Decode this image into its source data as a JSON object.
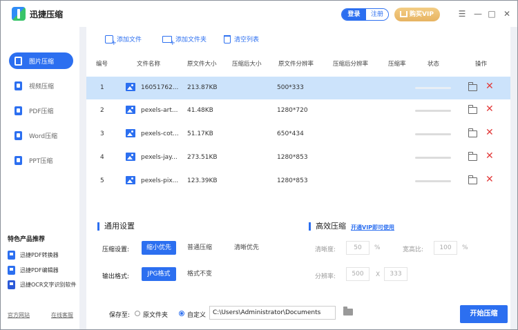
{
  "app": {
    "title": "迅捷压缩"
  },
  "header": {
    "login": "登录",
    "register": "注册",
    "vip": "购买VIP",
    "controls": {
      "menu": "☰",
      "minimize": "—",
      "maximize": "□",
      "close": "✕"
    }
  },
  "sidebar": {
    "items": [
      {
        "label": "图片压缩",
        "icon": "image-icon"
      },
      {
        "label": "视频压缩",
        "icon": "video-icon"
      },
      {
        "label": "PDF压缩",
        "icon": "pdf-icon"
      },
      {
        "label": "Word压缩",
        "icon": "word-icon"
      },
      {
        "label": "PPT压缩",
        "icon": "ppt-icon"
      }
    ],
    "featured_title": "特色产品推荐",
    "featured": [
      {
        "label": "迅捷PDF转换器",
        "icon": "pdf-converter-icon"
      },
      {
        "label": "迅捷PDF编辑器",
        "icon": "pdf-editor-icon"
      },
      {
        "label": "迅捷OCR文字识别软件",
        "icon": "ocr-icon"
      }
    ],
    "links": {
      "website": "官方网站",
      "support": "在线客服"
    }
  },
  "toolbar": {
    "add_file": "添加文件",
    "add_folder": "添加文件夹",
    "clear_list": "清空列表"
  },
  "table": {
    "headers": [
      "编号",
      "文件名称",
      "原文件大小",
      "压缩后大小",
      "原文件分辨率",
      "压缩后分辨率",
      "压缩率",
      "状态",
      "操作"
    ],
    "rows": [
      {
        "no": "1",
        "name": "16051762...",
        "size": "213.87KB",
        "resolution": "500*333"
      },
      {
        "no": "2",
        "name": "pexels-art...",
        "size": "41.48KB",
        "resolution": "1280*720"
      },
      {
        "no": "3",
        "name": "pexels-cot...",
        "size": "51.17KB",
        "resolution": "650*434"
      },
      {
        "no": "4",
        "name": "pexels-jay...",
        "size": "273.51KB",
        "resolution": "1280*853"
      },
      {
        "no": "5",
        "name": "pexels-pix...",
        "size": "123.39KB",
        "resolution": "1280*853"
      }
    ],
    "delete_glyph": "✕"
  },
  "settings": {
    "general_title": "通用设置",
    "compress_label": "压缩设置:",
    "compress_options": [
      "缩小优先",
      "普通压缩",
      "清晰优先"
    ],
    "format_label": "输出格式:",
    "format_options": [
      "JPG格式",
      "格式不变"
    ],
    "advanced_title": "高效压缩",
    "vip_link": "开通VIP即可使用",
    "clarity_label": "清晰度:",
    "clarity_value": "50",
    "clarity_unit": "%",
    "ratio_label": "宽高比:",
    "ratio_value": "100",
    "ratio_unit": "%",
    "resolution_label": "分辨率:",
    "res_w": "500",
    "res_x": "X",
    "res_h": "333"
  },
  "bottom": {
    "save_to": "保存至:",
    "orig_folder": "原文件夹",
    "custom": "自定义",
    "path": "C:\\Users\\Administrator\\Documents",
    "start": "开始压缩"
  }
}
